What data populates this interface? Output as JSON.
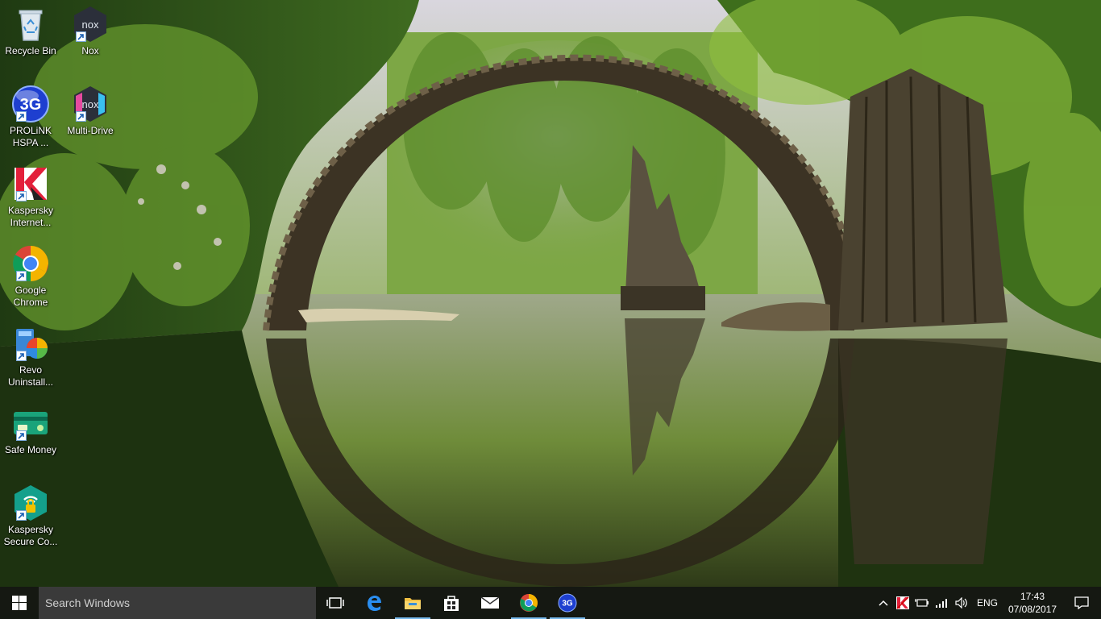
{
  "desktop": {
    "icons_col1": [
      {
        "label": "Recycle Bin",
        "icon": "recycle-bin-icon",
        "shortcut": false
      },
      {
        "label": "PROLiNK\nHSPA ...",
        "icon": "prolink-3g-icon",
        "shortcut": true
      },
      {
        "label": "Kaspersky\nInternet...",
        "icon": "kaspersky-internet-icon",
        "shortcut": true
      },
      {
        "label": "Google\nChrome",
        "icon": "chrome-icon",
        "shortcut": true
      },
      {
        "label": "Revo\nUninstall...",
        "icon": "revo-uninstaller-icon",
        "shortcut": true
      },
      {
        "label": "Safe Money",
        "icon": "safe-money-icon",
        "shortcut": true
      },
      {
        "label": "Kaspersky\nSecure Co...",
        "icon": "kaspersky-secure-connection-icon",
        "shortcut": true
      }
    ],
    "icons_col2": [
      {
        "label": "Nox",
        "icon": "nox-icon",
        "shortcut": true
      },
      {
        "label": "Multi-Drive",
        "icon": "nox-multi-drive-icon",
        "shortcut": true
      }
    ]
  },
  "taskbar": {
    "search_placeholder": "Search Windows",
    "pinned": [
      {
        "name": "task-view-icon",
        "running": false
      },
      {
        "name": "edge-icon",
        "running": false
      },
      {
        "name": "file-explorer-icon",
        "running": true
      },
      {
        "name": "store-icon",
        "running": false
      },
      {
        "name": "mail-icon",
        "running": false
      },
      {
        "name": "chrome-icon",
        "running": true
      },
      {
        "name": "prolink-3g-icon",
        "running": true
      }
    ],
    "tray": {
      "language": "ENG",
      "time": "17:43",
      "date": "07/08/2017"
    }
  },
  "colors": {
    "taskbar_bg": "#101010",
    "search_bg": "#3a3a3a",
    "running_indicator": "#76b9ed"
  }
}
